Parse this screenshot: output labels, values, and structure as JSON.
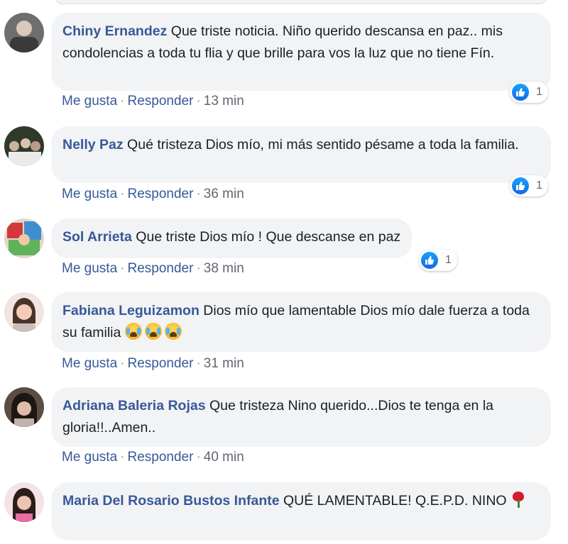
{
  "comments": [
    {
      "author": "Chiny Ernandez",
      "text": " Que triste noticia. Niño querido descansa en paz.. mis condolencias a toda tu flia y que brille para vos la luz que no tiene Fín.",
      "reaction_count": "1",
      "time": "13 min"
    },
    {
      "author": "Nelly Paz",
      "text": " Qué tristeza Dios mío, mi más sentido pésame a toda la familia.",
      "reaction_count": "1",
      "time": "36 min"
    },
    {
      "author": "Sol Arrieta",
      "text": " Que triste Dios mío ! Que descanse en paz",
      "reaction_count": "1",
      "time": "38 min"
    },
    {
      "author": "Fabiana Leguizamon",
      "text": " Dios mío que lamentable Dios mío dale fuerza a toda su familia ",
      "time": "31 min"
    },
    {
      "author": "Adriana Baleria Rojas",
      "text": " Que tristeza Nino querido...Dios te tenga en la gloria!!..Amen..",
      "time": "40 min"
    },
    {
      "author": "Maria Del Rosario Bustos Infante",
      "text": " QUÉ LAMENTABLE! Q.E.P.D. NINO "
    }
  ],
  "actions": {
    "like": "Me gusta",
    "reply": "Responder",
    "separator": "·"
  },
  "icons": {
    "reaction": "like-icon",
    "emoji": "crying-face-icon",
    "rose": "rose-icon"
  },
  "colors": {
    "author": "#385898",
    "bubble": "#f2f3f5",
    "meta": "#616770",
    "like": "#1877f2"
  }
}
